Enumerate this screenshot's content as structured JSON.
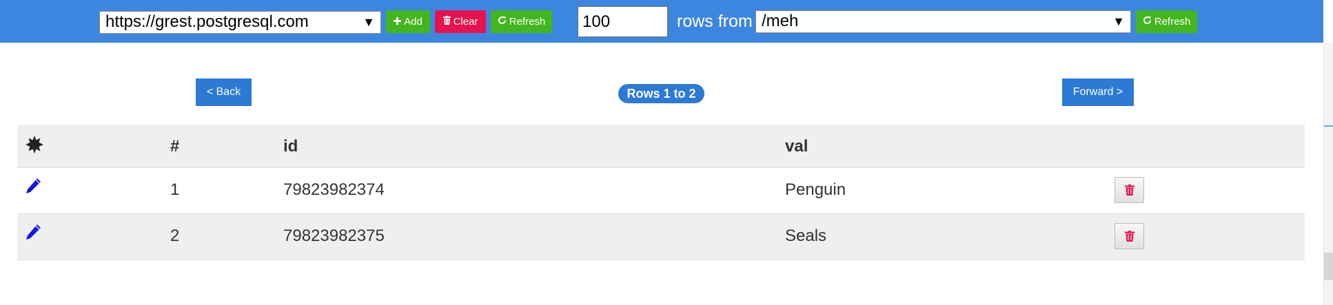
{
  "toolbar": {
    "server_url": "https://grest.postgresql.com",
    "add_label": "Add",
    "clear_label": "Clear",
    "refresh_label": "Refresh",
    "row_limit": "100",
    "rows_from_label": "rows from",
    "table_path": "/meh",
    "refresh2_label": "Refresh",
    "add_icon": "plus-icon",
    "clear_icon": "trash-icon",
    "refresh_icon": "refresh-icon",
    "dropdown_icon": "caret-down-icon"
  },
  "pager": {
    "back_label": "< Back",
    "rows_info": "Rows 1 to 2",
    "forward_label": "Forward >"
  },
  "table": {
    "columns": {
      "actions_icon": "settings-burst-icon",
      "num": "#",
      "id": "id",
      "val": "val"
    },
    "rows": [
      {
        "num": "1",
        "id": "79823982374",
        "val": "Penguin",
        "edit_icon": "pencil-icon",
        "delete_icon": "trash-icon"
      },
      {
        "num": "2",
        "id": "79823982375",
        "val": "Seals",
        "edit_icon": "pencil-icon",
        "delete_icon": "trash-icon"
      }
    ]
  },
  "colors": {
    "toolbar_bg": "#3d86e0",
    "primary": "#2d7ad6",
    "success": "#43b51f",
    "danger": "#e7124d",
    "edit_icon": "#1515e8",
    "row_stripe": "#efefef"
  }
}
